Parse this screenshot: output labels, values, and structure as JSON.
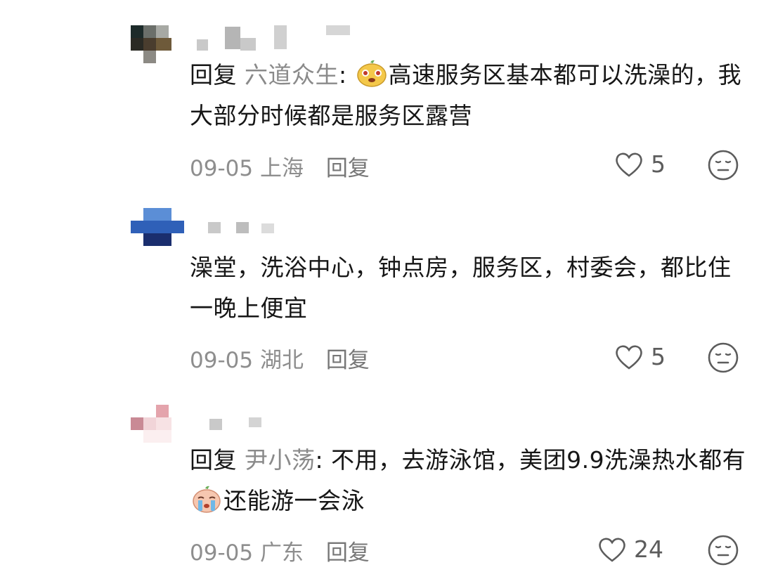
{
  "comments": [
    {
      "body_parts": {
        "reply_prefix": "回复 ",
        "reply_to": "六道众生",
        "text_before": ": ",
        "text_after": "高速服务区基本都可以洗澡的，我大部分时候都是服务区露营"
      },
      "has_emoji": true,
      "emoji": "laughing-face-emoji",
      "date": "09-05",
      "location": "上海",
      "reply_label": "回复",
      "likes": "5"
    },
    {
      "body_parts": {
        "reply_prefix": "",
        "reply_to": "",
        "text_before": "澡堂，洗浴中心，钟点房，服务区，村委会，都比住一晚上便宜",
        "text_after": ""
      },
      "has_emoji": false,
      "date": "09-05",
      "location": "湖北",
      "reply_label": "回复",
      "likes": "5"
    },
    {
      "body_parts": {
        "reply_prefix": "回复 ",
        "reply_to": "尹小荡",
        "text_before": ": 不用，去游泳馆，美团9.9洗澡热水都有",
        "text_after": "还能游一会泳"
      },
      "has_emoji": true,
      "emoji": "crying-face-emoji",
      "date": "09-05",
      "location": "广东",
      "reply_label": "回复",
      "likes": "24"
    }
  ],
  "icons": {
    "like": "heart-outline-icon",
    "dislike": "meh-face-icon"
  },
  "colors": {
    "text": "#161616",
    "secondary": "#8e8e8e",
    "reply_name": "#8a8a8a",
    "icon": "#5c5c5c"
  }
}
